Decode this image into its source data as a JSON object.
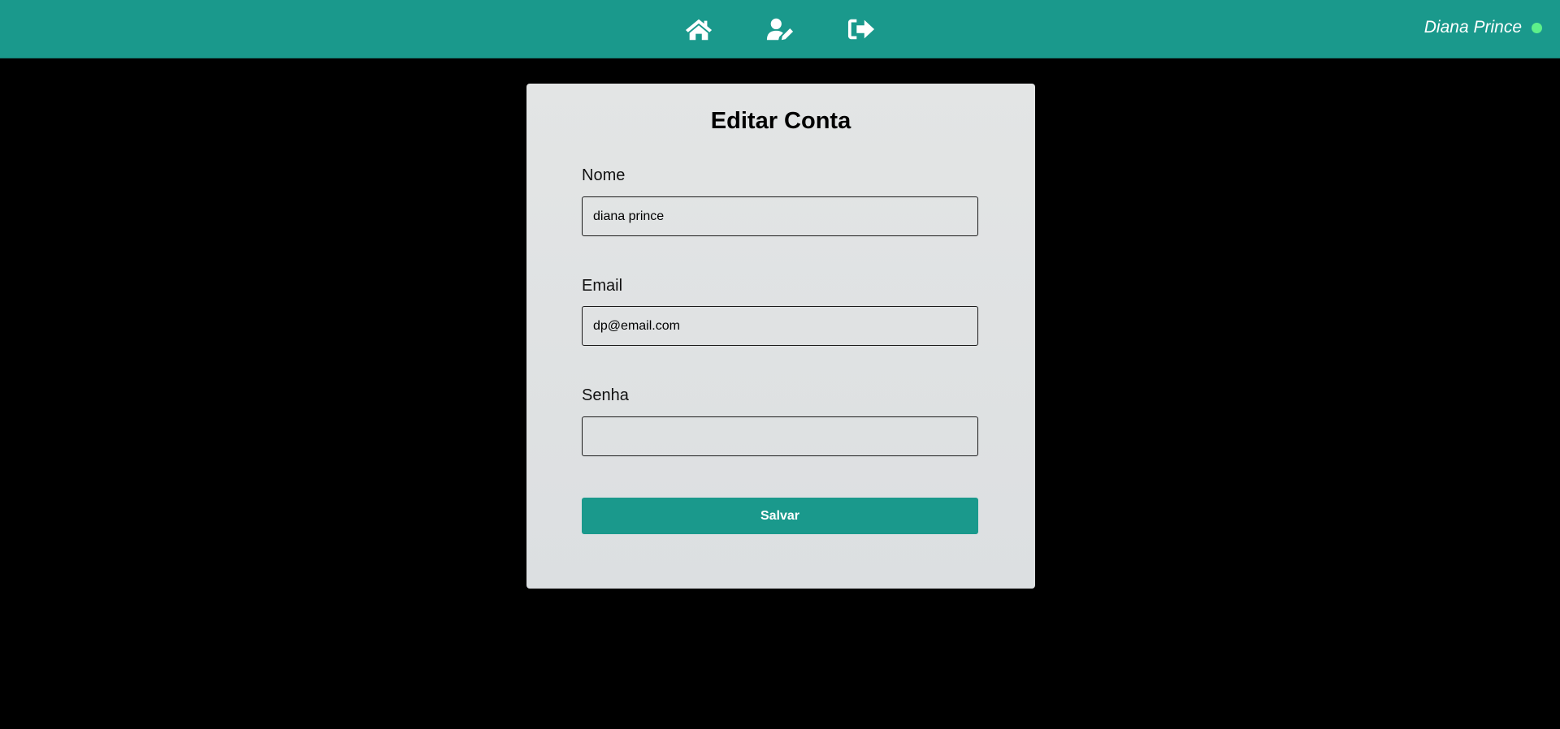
{
  "header": {
    "nav": [
      {
        "icon": "home-icon"
      },
      {
        "icon": "user-edit-icon"
      },
      {
        "icon": "sign-out-icon"
      }
    ],
    "user_name": "Diana Prince",
    "status_color": "#5ef08a",
    "background": "#1a998c"
  },
  "form": {
    "title": "Editar Conta",
    "name_label": "Nome",
    "name_value": "diana prince",
    "email_label": "Email",
    "email_value": "dp@email.com",
    "password_label": "Senha",
    "password_value": "",
    "save_label": "Salvar"
  }
}
